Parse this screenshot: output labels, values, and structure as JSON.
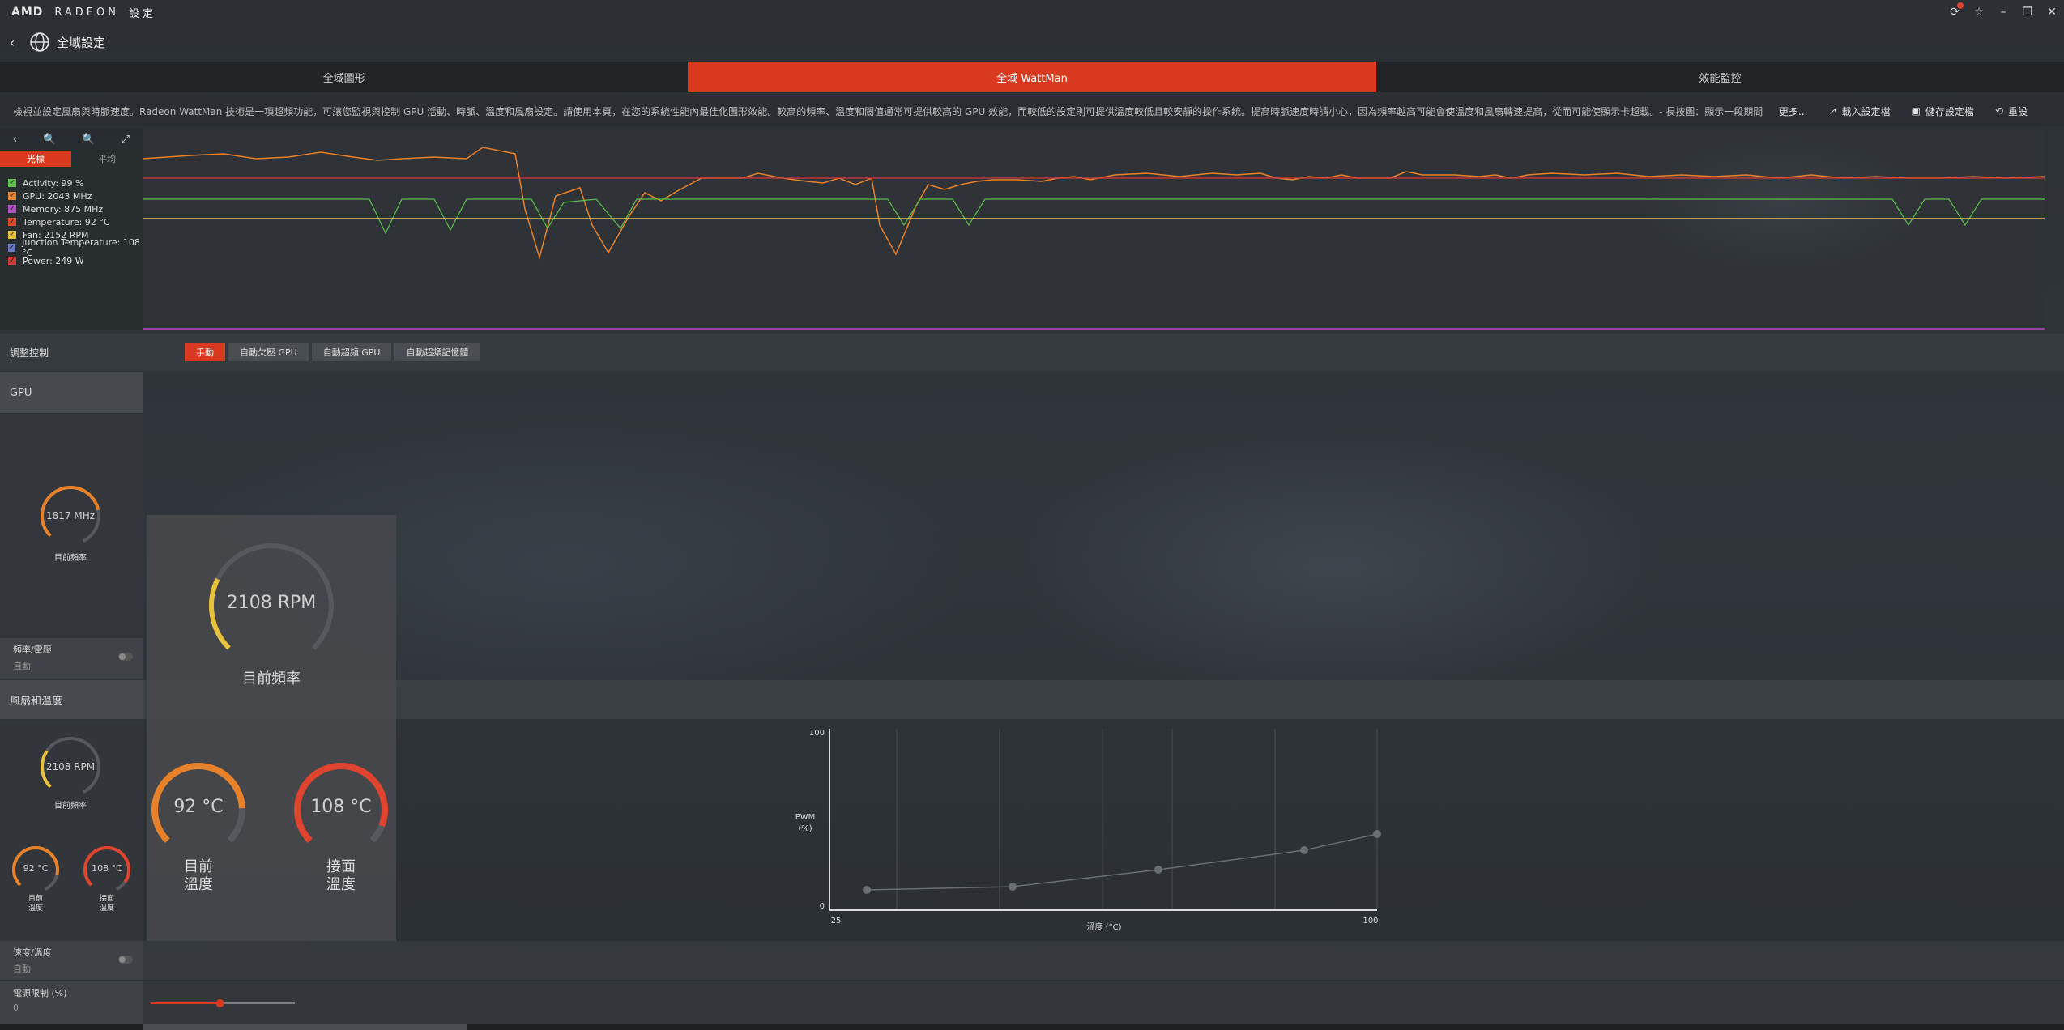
{
  "app": {
    "brand": "AMD",
    "product": "RADEON",
    "title": "設定"
  },
  "breadcrumb": {
    "label": "全域設定"
  },
  "tabs": [
    {
      "label": "全域圖形",
      "active": false
    },
    {
      "label": "全域 WattMan",
      "active": true
    },
    {
      "label": "效能監控",
      "active": false
    }
  ],
  "description": {
    "text": "檢視並設定風扇與時脈速度。Radeon WattMan 技術是一項超頻功能，可讓您監視與控制 GPU 活動、時脈、溫度和風扇設定。請使用本頁，在您的系統性能內最佳化圖形效能。較高的頻率、溫度和閾值通常可提供較高的 GPU 效能，而較低的設定則可提供溫度較低且較安靜的操作系統。提高時脈速度時請小心，因為頻率越高可能會使溫度和風扇轉速提高，從而可能使顯示卡超載。- 長按圖：顯示一段期間...",
    "more": "更多...",
    "load_profile": "載入設定檔",
    "save_profile": "儲存設定檔",
    "reset": "重設"
  },
  "chart_panel": {
    "mode_live": "光標",
    "mode_avg": "平均",
    "legend": [
      {
        "label": "Activity: 99 %",
        "color": "#5cc04a"
      },
      {
        "label": "GPU: 2043 MHz",
        "color": "#e8822a"
      },
      {
        "label": "Memory: 875 MHz",
        "color": "#b050c0"
      },
      {
        "label": "Temperature: 92 °C",
        "color": "#e04a2a"
      },
      {
        "label": "Fan: 2152 RPM",
        "color": "#e8c23a"
      },
      {
        "label": "Junction Temperature: 108 °C",
        "color": "#6a7ac0"
      },
      {
        "label": "Power: 249 W",
        "color": "#d03a3a"
      }
    ]
  },
  "tuning": {
    "label": "調整控制",
    "options": [
      {
        "label": "手動",
        "active": true
      },
      {
        "label": "自動欠壓 GPU",
        "active": false
      },
      {
        "label": "自動超頻 GPU",
        "active": false
      },
      {
        "label": "自動超頻記憶體",
        "active": false
      }
    ]
  },
  "gpu_section": {
    "header": "GPU",
    "freq_value": "1817 MHz",
    "freq_label": "目前頻率",
    "freq_voltage_label": "頻率/電壓",
    "freq_voltage_sub": "自動"
  },
  "fan_section": {
    "header": "風扇和溫度",
    "rpm_value": "2108 RPM",
    "rpm_label": "目前頻率",
    "temp_value": "92 °C",
    "temp_label_1": "目前",
    "temp_label_2": "溫度",
    "junction_value": "108 °C",
    "junction_label_1": "接面",
    "junction_label_2": "溫度",
    "speed_temp_label": "速度/溫度",
    "speed_temp_sub": "自動"
  },
  "power": {
    "label": "電源限制 (%)",
    "value": "0",
    "slider_fraction": 0.48
  },
  "popup": {
    "rpm_value": "2108 RPM",
    "rpm_label": "目前頻率",
    "temp_value": "92 °C",
    "temp_label_1": "目前",
    "temp_label_2": "溫度",
    "junction_value": "108 °C",
    "junction_label_1": "接面",
    "junction_label_2": "溫度"
  },
  "fan_curve": {
    "y_label_1": "PWM",
    "y_label_2": "(%)",
    "x_label": "溫度 (°C)",
    "y_max": "100",
    "y_min": "0",
    "x_min": "25",
    "x_max": "100"
  },
  "colors": {
    "accent": "#d9391e",
    "orange": "#e8822a",
    "yellow": "#e8c23a",
    "red": "#e0442e"
  }
}
